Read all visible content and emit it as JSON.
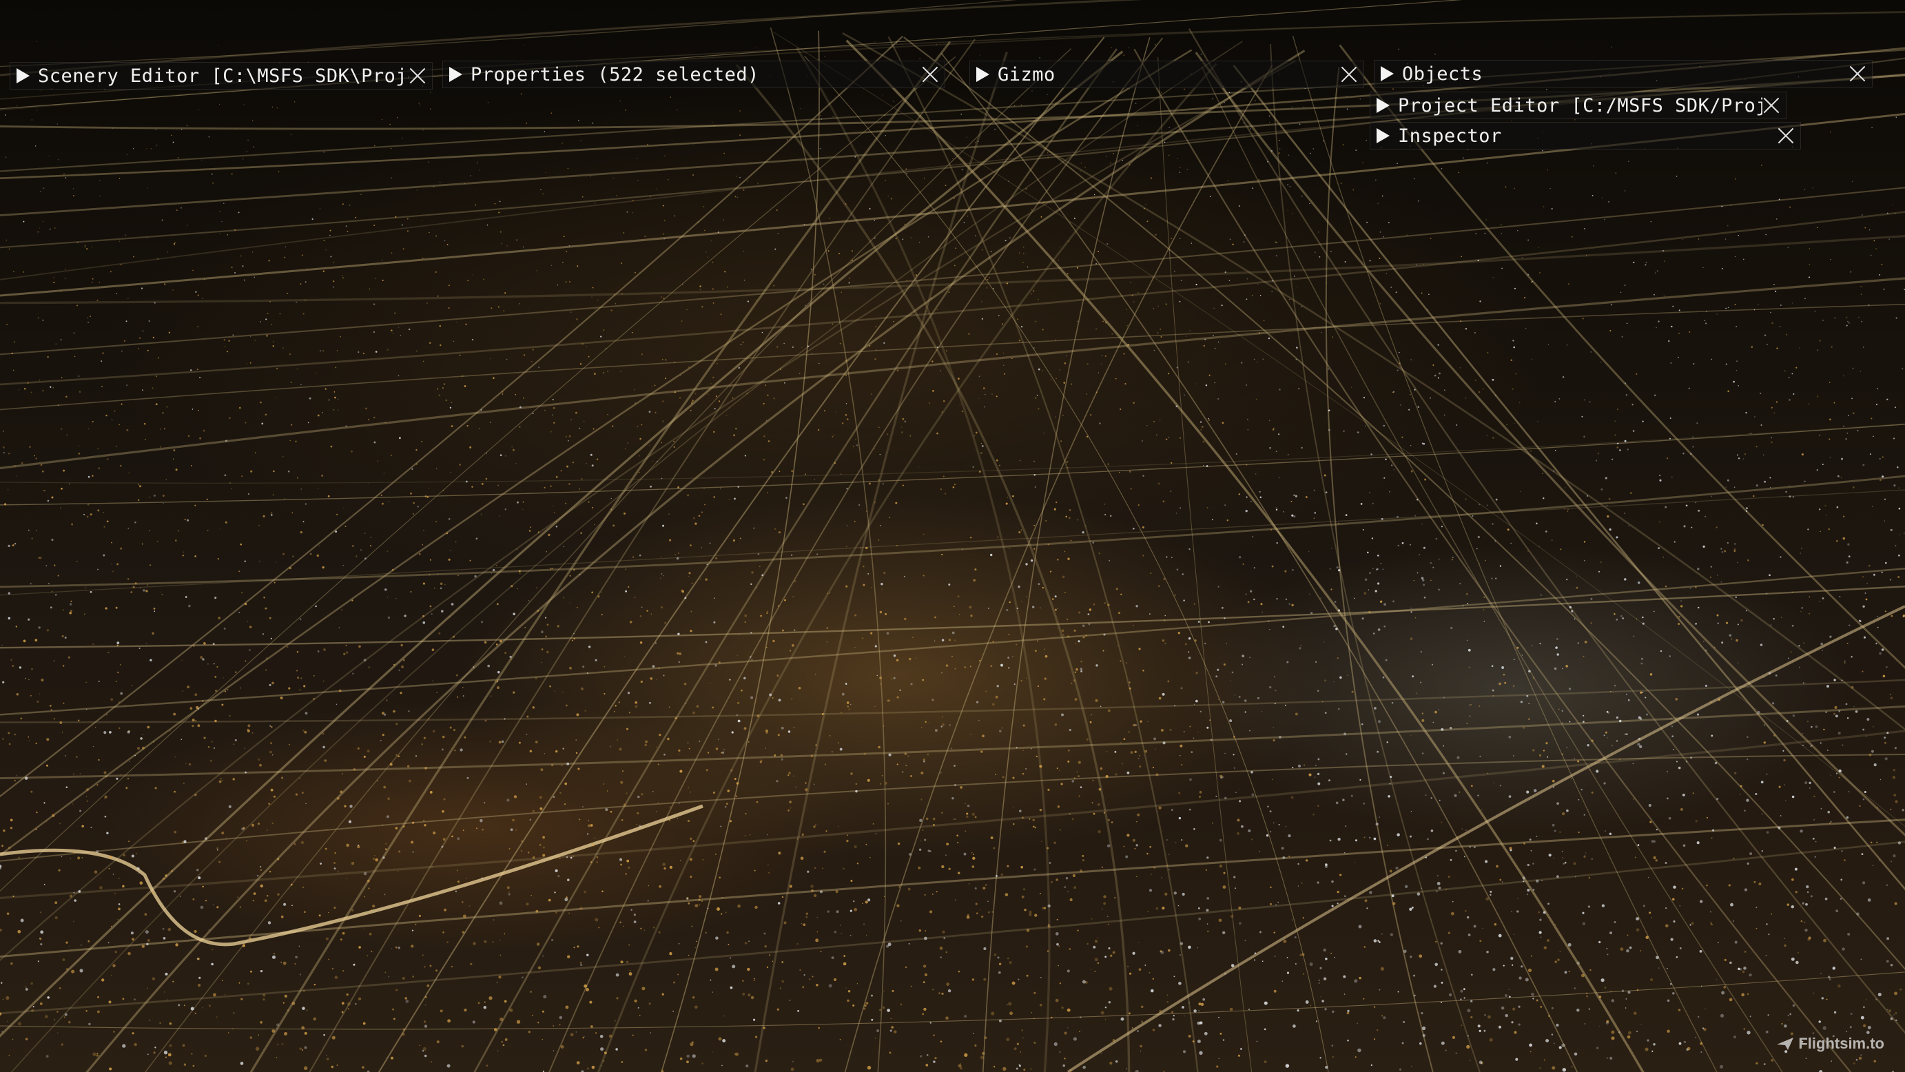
{
  "panels": {
    "scenery_editor": {
      "title": "Scenery Editor [C:\\MSFS SDK\\Projects"
    },
    "properties": {
      "title": "Properties (522 selected)"
    },
    "gizmo": {
      "title": "Gizmo"
    },
    "objects": {
      "title": "Objects"
    },
    "project_editor": {
      "title": "Project Editor [C:/MSFS SDK/Projects"
    },
    "inspector": {
      "title": "Inspector"
    }
  },
  "icons": {
    "expand": "triangle-right-icon",
    "close": "close-icon",
    "watermark_logo": "plane-icon"
  },
  "watermark": {
    "text": "Flightsim.to"
  },
  "colors": {
    "city_light_warm": "#d9a44a",
    "city_light_white": "#e8ecf0",
    "road_light": "#c8b27a",
    "ground_dark": "#1e1710",
    "panel_bg": "#101010",
    "panel_text": "#f0f0f0"
  }
}
